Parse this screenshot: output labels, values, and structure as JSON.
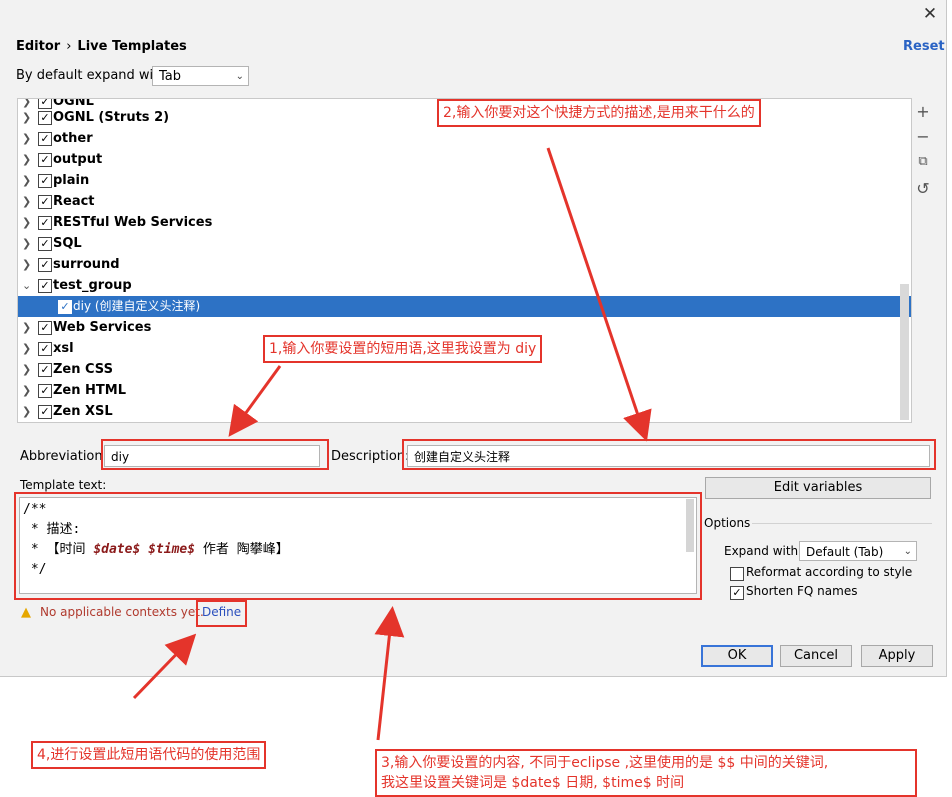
{
  "header": {
    "breadcrumb_root": "Editor",
    "breadcrumb_sep": "›",
    "breadcrumb_leaf": "Live Templates",
    "reset": "Reset",
    "close_glyph": "✕"
  },
  "expand_default": {
    "label": "By default expand with",
    "value": "Tab"
  },
  "tree": {
    "partial_top": "OGNL",
    "items": [
      {
        "label": "OGNL (Struts 2)"
      },
      {
        "label": "other"
      },
      {
        "label": "output"
      },
      {
        "label": "plain"
      },
      {
        "label": "React"
      },
      {
        "label": "RESTful Web Services"
      },
      {
        "label": "SQL"
      },
      {
        "label": "surround"
      },
      {
        "label": "test_group"
      },
      {
        "label": "diy (创建自定义头注释)"
      },
      {
        "label": "Web Services"
      },
      {
        "label": "xsl"
      },
      {
        "label": "Zen CSS"
      },
      {
        "label": "Zen HTML"
      },
      {
        "label": "Zen XSL"
      }
    ]
  },
  "toolbar": {
    "add": "+",
    "remove": "−",
    "copy": "⧉",
    "restore": "↺"
  },
  "form": {
    "abbreviation_label": "Abbreviation:",
    "abbreviation_value": "diy",
    "description_label": "Description:",
    "description_value": "创建自定义头注释",
    "template_text_label": "Template text:",
    "template_lines": [
      "/**",
      " * 描述:",
      " * 【时间 ",
      "$date$",
      "$time$",
      " 作者 陶攀峰】",
      " */"
    ],
    "edit_variables": "Edit variables"
  },
  "options": {
    "title": "Options",
    "expand_with_label": "Expand with",
    "expand_with_value": "Default (Tab)",
    "reformat_label": "Reformat according to style",
    "reformat_checked": false,
    "shorten_label": "Shorten FQ names",
    "shorten_checked": true
  },
  "warning": {
    "text": "No applicable contexts yet.",
    "define": "Define"
  },
  "buttons": {
    "ok": "OK",
    "cancel": "Cancel",
    "apply": "Apply"
  },
  "annotations": {
    "note1": "1,输入你要设置的短用语,这里我设置为 diy",
    "note2": "2,输入你要对这个快捷方式的描述,是用来干什么的",
    "note3_line1": "3,输入你要设置的内容, 不同于eclipse ,这里使用的是 $$ 中间的关键词,",
    "note3_line2": "我这里设置关键词是 $date$ 日期, $time$ 时间",
    "note4": "4,进行设置此短用语代码的使用范围"
  },
  "colors": {
    "accent": "#2d72c5",
    "annotation_red": "#e4342b",
    "variable": "#8b1a1a"
  }
}
